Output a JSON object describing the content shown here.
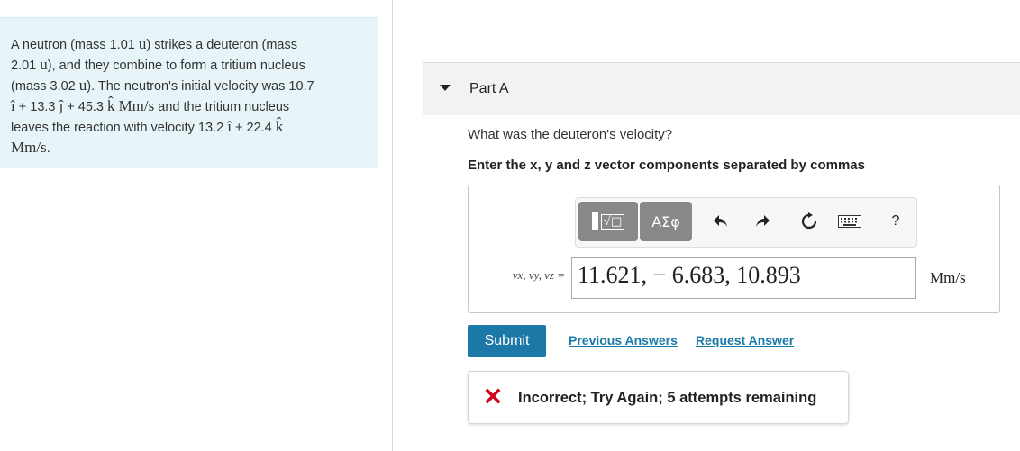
{
  "problem": {
    "line1": "A neutron (mass 1.01 ",
    "mass_unit": "u",
    "line1_end": ") strikes a deuteron (mass",
    "line2": "2.01 ",
    "line2_end": "), and they combine to form a tritium nucleus",
    "line3": "(mass 3.02 ",
    "line3_end": "). The neutron's initial velocity was  10.7",
    "i_hat": "î",
    "j_hat": "ĵ",
    "k_hat": "k̂",
    "line4_a": " + 13.3 ",
    "line4_b": " + 45.3 ",
    "velocity_unit": "Mm/s",
    "line4_end": " and the tritium nucleus",
    "line5": "leaves the reaction with velocity  13.2 ",
    "line5_b": "  +  22.4 ",
    "final_unit": "Mm/s",
    "period": "."
  },
  "part": {
    "title": "Part A",
    "question": "What was the deuteron's velocity?",
    "instructions": "Enter the x, y and z vector components separated by commas"
  },
  "toolbar": {
    "symbols_label": "ΑΣφ",
    "templates_radical": "√□",
    "help_label": "?",
    "icons": [
      "templates-icon",
      "greek-symbols-icon",
      "undo-icon",
      "redo-icon",
      "reset-icon",
      "keyboard-icon",
      "help-icon"
    ]
  },
  "answer": {
    "var_label": "vx, vy, vz =",
    "value": "11.621, − 6.683, 10.893",
    "units": "Mm/s"
  },
  "actions": {
    "submit_label": "Submit",
    "previous_answers": "Previous Answers",
    "request_answer": "Request Answer"
  },
  "feedback": {
    "text": "Incorrect; Try Again; 5 attempts remaining",
    "status_color": "#d0021b"
  },
  "colors": {
    "problem_bg": "#e8f5f8",
    "accent": "#1c78a6",
    "link": "#1a7aa9"
  }
}
